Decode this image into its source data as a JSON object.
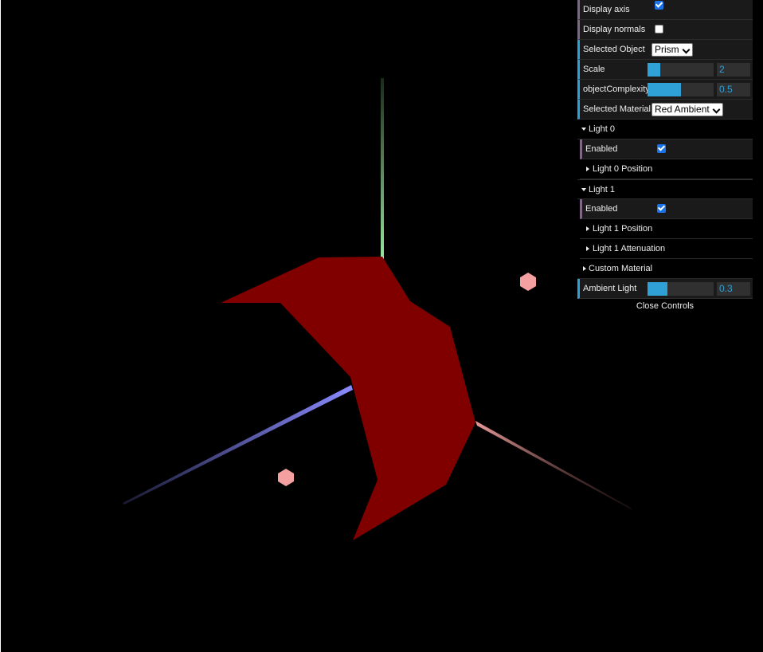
{
  "controls": {
    "display_axis": {
      "label": "Display axis",
      "checked": true
    },
    "display_normals": {
      "label": "Display normals",
      "checked": false
    },
    "selected_object": {
      "label": "Selected Object",
      "value": "Prism"
    },
    "scale": {
      "label": "Scale",
      "value": "2",
      "level": 0.2
    },
    "object_complexity": {
      "label": "objectComplexity",
      "value": "0.5",
      "level": 0.5
    },
    "selected_material": {
      "label": "Selected Material",
      "value": "Red Ambient"
    },
    "light0": {
      "title": "Light 0",
      "enabled": {
        "label": "Enabled",
        "checked": true
      },
      "position": "Light 0 Position"
    },
    "light1": {
      "title": "Light 1",
      "enabled": {
        "label": "Enabled",
        "checked": true
      },
      "position": "Light 1 Position",
      "attenuation": "Light 1 Attenuation"
    },
    "custom_material": "Custom Material",
    "ambient_light": {
      "label": "Ambient Light",
      "value": "0.3",
      "level": 0.3
    },
    "close": "Close Controls"
  },
  "colors": {
    "prism": "#800000",
    "axis_x": "#e89a9a",
    "axis_y": "#9be39b",
    "axis_z": "#8a8aff",
    "light_marker": "#f4a0a0",
    "gui_accent": "#2fa1d6"
  }
}
